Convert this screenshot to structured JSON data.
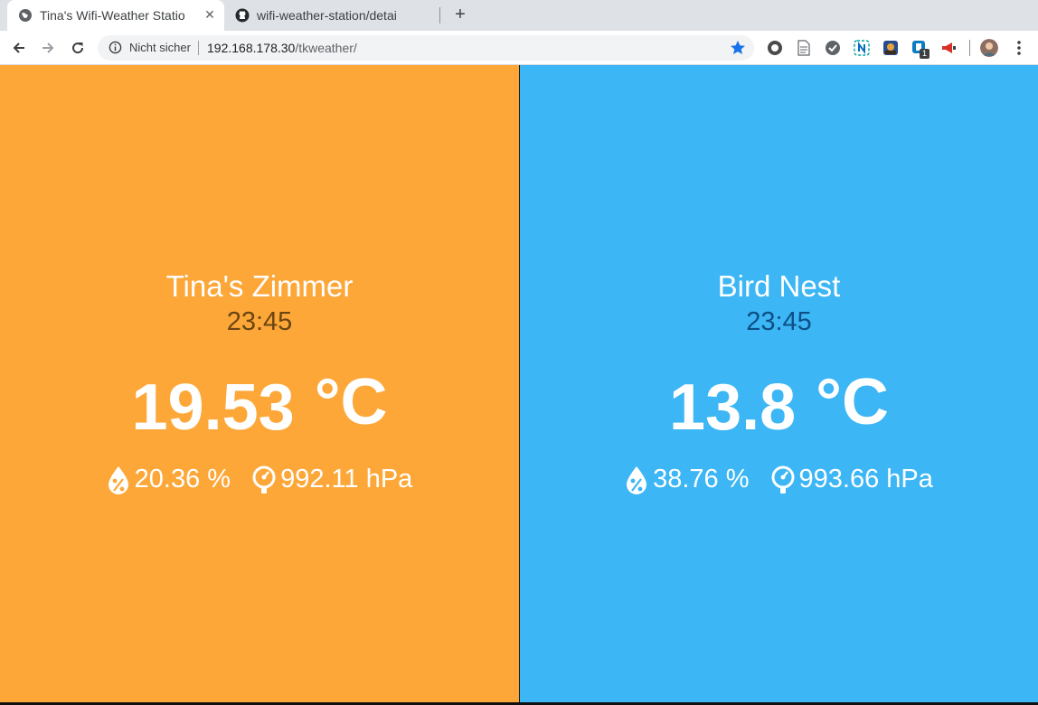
{
  "browser": {
    "tabs": [
      {
        "title": "Tina's Wifi-Weather Statio",
        "active": true,
        "icon": "globe-icon"
      },
      {
        "title": "wifi-weather-station/detai",
        "active": false,
        "icon": "github-icon"
      }
    ],
    "new_tab_label": "+",
    "close_glyph": "✕",
    "security_label": "Nicht sicher",
    "url_host": "192.168.178.30",
    "url_path": "/tkweather/",
    "extension_badge": "1"
  },
  "stations": [
    {
      "name": "Tina's Zimmer",
      "time": "23:45",
      "temperature": "19.53",
      "temp_unit": "°C",
      "humidity": "20.36 %",
      "pressure": "992.11 hPa",
      "background": "#fda739",
      "time_color": "#6b4512"
    },
    {
      "name": "Bird Nest",
      "time": "23:45",
      "temperature": "13.8",
      "temp_unit": "°C",
      "humidity": "38.76 %",
      "pressure": "993.66 hPa",
      "background": "#3cb6f4",
      "time_color": "#0e4f86"
    }
  ]
}
